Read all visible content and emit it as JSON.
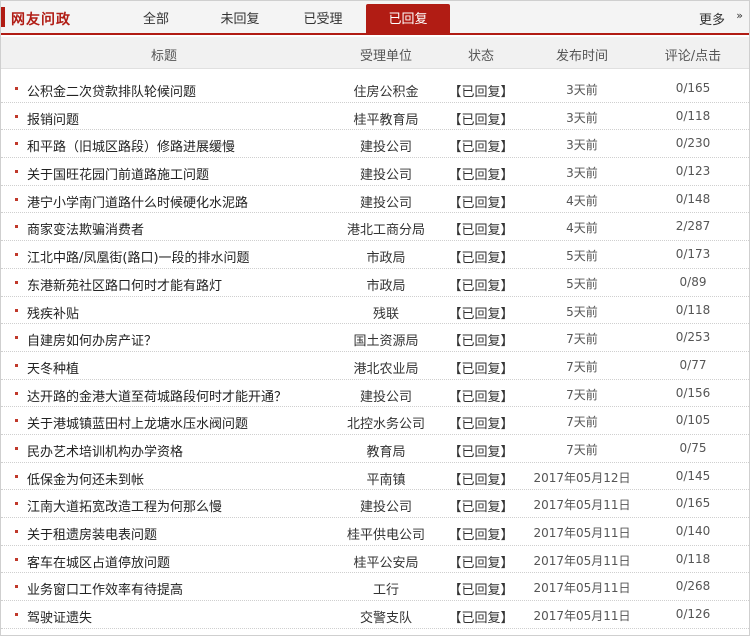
{
  "header": {
    "brand": "网友问政",
    "tabs": [
      {
        "label": "全部",
        "active": false
      },
      {
        "label": "未回复",
        "active": false
      },
      {
        "label": "已受理",
        "active": false
      },
      {
        "label": "已回复",
        "active": true
      }
    ],
    "more_label": "更多",
    "more_icon": "»"
  },
  "table": {
    "columns": [
      "标题",
      "受理单位",
      "状态",
      "发布时间",
      "评论/点击"
    ],
    "rows": [
      {
        "title": "公积金二次贷款排队轮候问题",
        "dept": "住房公积金",
        "status": "【已回复】",
        "time": "3天前",
        "stats": "0/165"
      },
      {
        "title": "报销问题",
        "dept": "桂平教育局",
        "status": "【已回复】",
        "time": "3天前",
        "stats": "0/118"
      },
      {
        "title": "和平路（旧城区路段）修路进展缓慢",
        "dept": "建投公司",
        "status": "【已回复】",
        "time": "3天前",
        "stats": "0/230"
      },
      {
        "title": "关于国旺花园门前道路施工问题",
        "dept": "建投公司",
        "status": "【已回复】",
        "time": "3天前",
        "stats": "0/123"
      },
      {
        "title": "港宁小学南门道路什么时候硬化水泥路",
        "dept": "建投公司",
        "status": "【已回复】",
        "time": "4天前",
        "stats": "0/148"
      },
      {
        "title": "商家变法欺骗消费者",
        "dept": "港北工商分局",
        "status": "【已回复】",
        "time": "4天前",
        "stats": "2/287"
      },
      {
        "title": "江北中路/凤凰街(路口)一段的排水问题",
        "dept": "市政局",
        "status": "【已回复】",
        "time": "5天前",
        "stats": "0/173"
      },
      {
        "title": "东港新苑社区路口何时才能有路灯",
        "dept": "市政局",
        "status": "【已回复】",
        "time": "5天前",
        "stats": "0/89"
      },
      {
        "title": "残疾补贴",
        "dept": "残联",
        "status": "【已回复】",
        "time": "5天前",
        "stats": "0/118"
      },
      {
        "title": "自建房如何办房产证？",
        "dept": "国土资源局",
        "status": "【已回复】",
        "time": "7天前",
        "stats": "0/253"
      },
      {
        "title": "天冬种植",
        "dept": "港北农业局",
        "status": "【已回复】",
        "time": "7天前",
        "stats": "0/77"
      },
      {
        "title": "达开路的金港大道至荷城路段何时才能开通？",
        "dept": "建投公司",
        "status": "【已回复】",
        "time": "7天前",
        "stats": "0/156"
      },
      {
        "title": "关于港城镇蓝田村上龙塘水压水阀问题",
        "dept": "北控水务公司",
        "status": "【已回复】",
        "time": "7天前",
        "stats": "0/105"
      },
      {
        "title": "民办艺术培训机构办学资格",
        "dept": "教育局",
        "status": "【已回复】",
        "time": "7天前",
        "stats": "0/75"
      },
      {
        "title": "低保金为何还未到帐",
        "dept": "平南镇",
        "status": "【已回复】",
        "time": "2017年05月12日",
        "stats": "0/145"
      },
      {
        "title": "江南大道拓宽改造工程为何那么慢",
        "dept": "建投公司",
        "status": "【已回复】",
        "time": "2017年05月11日",
        "stats": "0/165"
      },
      {
        "title": "关于租遗房装电表问题",
        "dept": "桂平供电公司",
        "status": "【已回复】",
        "time": "2017年05月11日",
        "stats": "0/140"
      },
      {
        "title": "客车在城区占道停放问题",
        "dept": "桂平公安局",
        "status": "【已回复】",
        "time": "2017年05月11日",
        "stats": "0/118"
      },
      {
        "title": "业务窗口工作效率有待提高",
        "dept": "工行",
        "status": "【已回复】",
        "time": "2017年05月11日",
        "stats": "0/268"
      },
      {
        "title": "驾驶证遗失",
        "dept": "交警支队",
        "status": "【已回复】",
        "time": "2017年05月11日",
        "stats": "0/126"
      }
    ]
  },
  "colors": {
    "accent": "#b11c14",
    "bullet": "#c0392b",
    "header_bg": "#f1f1f1"
  }
}
